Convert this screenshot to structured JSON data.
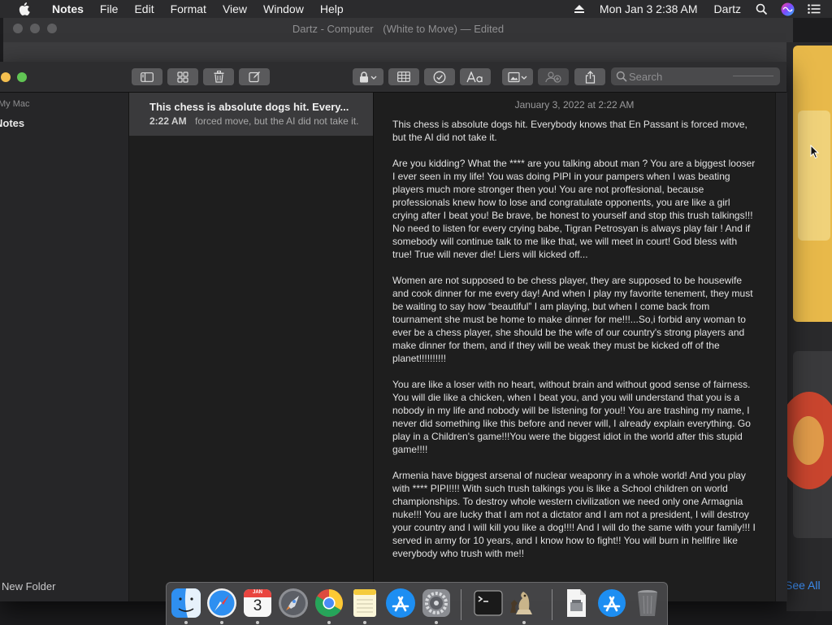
{
  "menubar": {
    "app_name": "Notes",
    "menus": [
      "File",
      "Edit",
      "Format",
      "View",
      "Window",
      "Help"
    ],
    "clock": "Mon Jan 3  2:38 AM",
    "user": "Dartz"
  },
  "background_window": {
    "title": "Dartz - Computer",
    "subtitle": "(White to Move)  — Edited"
  },
  "desktop": {
    "see_all": "See All"
  },
  "notes_window": {
    "search": {
      "placeholder": "Search"
    },
    "sidebar": {
      "header": "My Mac",
      "folder": "Notes",
      "new_folder": "New Folder"
    },
    "note_list": [
      {
        "title": "This chess is absolute dogs hit. Every...",
        "time": "2:22 AM",
        "preview": "forced move, but the AI did not take it."
      }
    ],
    "editor": {
      "date": "January 3, 2022 at 2:22 AM",
      "paragraphs": [
        "This chess is absolute dogs hit. Everybody knows that En Passant is forced move, but the AI did not take it.",
        "Are you kidding? What the **** are you talking about man ? You are a biggest looser I ever seen in my life! You was doing PIPI in your pampers when I was beating players much more stronger then you! You are not proffesional, because professionals knew how to lose and congratulate opponents, you are like a girl crying after I beat you! Be brave, be honest to yourself and stop this trush talkings!!! No need to listen for every crying babe, Tigran Petrosyan is always play fair ! And if somebody will continue talk to me like that, we will meet in court! God bless with true! True will never die! Liers will kicked off...",
        "Women are not supposed to be chess player, they are supposed to be housewife and cook dinner for me every day! And when I play my favorite tenement, they must be waiting to say how “beautiful” I am playing, but when I come back from tournament she must be home to make dinner for me!!!...So,i forbid any woman to ever be a chess player, she should be the wife of our country's strong players and make dinner for them, and if they will be weak they must be kicked off of the planet!!!!!!!!!!",
        "You are like a loser with no heart, without brain and without good sense of fairness. You will die like a chicken, when I beat you, and you will understand that you is a nobody in my life and nobody will be listening for you!! You are trashing my name, I never did something like this before and never will, I already explain everything. Go play in a Children's game!!!You were the biggest idiot in the world after this stupid game!!!!",
        "Armenia have biggest arsenal of nuclear weaponry in a whole world! And you play with **** PIPI!!!! With such trush talkings you is like a School children on world championships. To destroy whole western civilization we need only one Armagnia nuke!!! You are lucky that I am not a dictator and I am not a president, I will destroy your country and I will kill you like a dog!!!! And I will do the same with your family!!! I served in army for 10 years, and I know how to fight!! You will burn in hellfire like everybody who trush with me!!"
      ]
    }
  },
  "dock": {
    "calendar_month": "JAN",
    "calendar_day": "3",
    "apps": [
      "finder-icon",
      "safari-icon",
      "calendar-icon",
      "launchpad-icon",
      "chrome-icon",
      "notes-icon",
      "app-store-icon",
      "system-preferences-icon",
      "terminal-icon",
      "chess-icon",
      "preview-document-icon",
      "app-store-icon",
      "trash-icon"
    ]
  },
  "colors": {
    "accent": "#3c8cf0",
    "traffic_close": "#ec6a5e",
    "traffic_min": "#f4bf4f",
    "traffic_max": "#61c554"
  }
}
